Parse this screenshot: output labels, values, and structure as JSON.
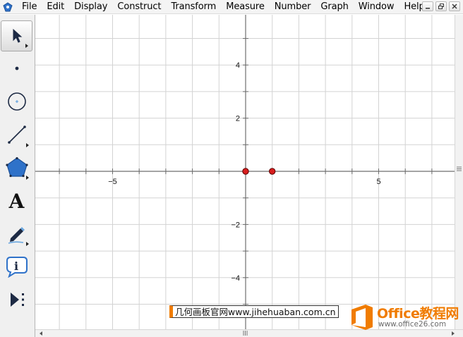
{
  "menu": {
    "items": [
      "File",
      "Edit",
      "Display",
      "Construct",
      "Transform",
      "Measure",
      "Number",
      "Graph",
      "Window",
      "Help"
    ]
  },
  "window_controls": [
    "minimize-icon",
    "restore-icon",
    "close-icon"
  ],
  "tools": [
    {
      "name": "arrow-selection-tool",
      "icon": "arrow-pointer-icon",
      "selected": true,
      "has_submenu": true
    },
    {
      "name": "point-tool",
      "icon": "point-icon",
      "selected": false,
      "has_submenu": false
    },
    {
      "name": "compass-tool",
      "icon": "circle-icon",
      "selected": false,
      "has_submenu": false
    },
    {
      "name": "straightedge-tool",
      "icon": "segment-icon",
      "selected": false,
      "has_submenu": true
    },
    {
      "name": "polygon-tool",
      "icon": "pentagon-icon",
      "selected": false,
      "has_submenu": true
    },
    {
      "name": "text-tool",
      "icon": "letter-a-icon",
      "label": "A",
      "selected": false,
      "has_submenu": false
    },
    {
      "name": "marker-tool",
      "icon": "pen-icon",
      "selected": false,
      "has_submenu": true
    },
    {
      "name": "information-tool",
      "icon": "info-bubble-icon",
      "selected": false,
      "has_submenu": false
    },
    {
      "name": "custom-tool",
      "icon": "play-menu-icon",
      "selected": false,
      "has_submenu": false
    }
  ],
  "graph": {
    "x_ticks": [
      {
        "value": -5,
        "label": "−5"
      },
      {
        "value": 5,
        "label": "5"
      }
    ],
    "y_ticks": [
      {
        "value": 4,
        "label": "4"
      },
      {
        "value": 2,
        "label": "2"
      },
      {
        "value": -2,
        "label": "−2"
      },
      {
        "value": -4,
        "label": "−4"
      }
    ],
    "points": [
      {
        "x": 0,
        "y": 0
      },
      {
        "x": 1,
        "y": 0
      }
    ],
    "point_color": "#d81e1e",
    "grid_color": "#d3d3d3",
    "axis_color": "#6e6e6e"
  },
  "watermarks": {
    "site": "几何画板官网www.jihehuaban.com.cn",
    "office_title": "Office教程网",
    "office_url": "www.office26.com",
    "accent": "#f07c00"
  }
}
